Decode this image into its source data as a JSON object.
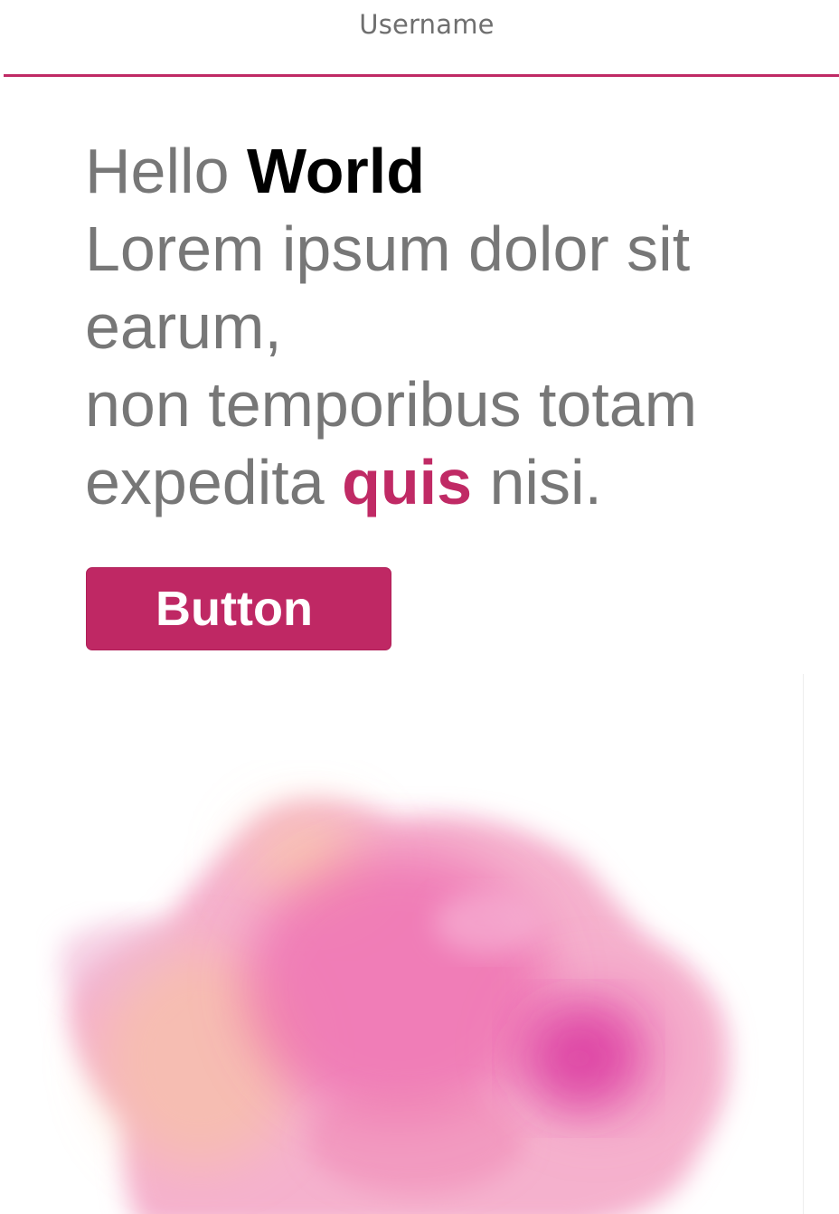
{
  "header": {
    "username": "Username",
    "accent_color": "#c02a65"
  },
  "hero": {
    "greeting": "Hello",
    "greeting_strong": "World",
    "line2": "Lorem ipsum dolor sit",
    "line3": "earum,",
    "line4": "non temporibus totam",
    "line5_start": "expedita",
    "line5_accent": "quis",
    "line5_end": "nisi."
  },
  "cta": {
    "label": "Button",
    "color": "#bf2864"
  },
  "illustration": {
    "icon": "watercolor-splash-image"
  }
}
